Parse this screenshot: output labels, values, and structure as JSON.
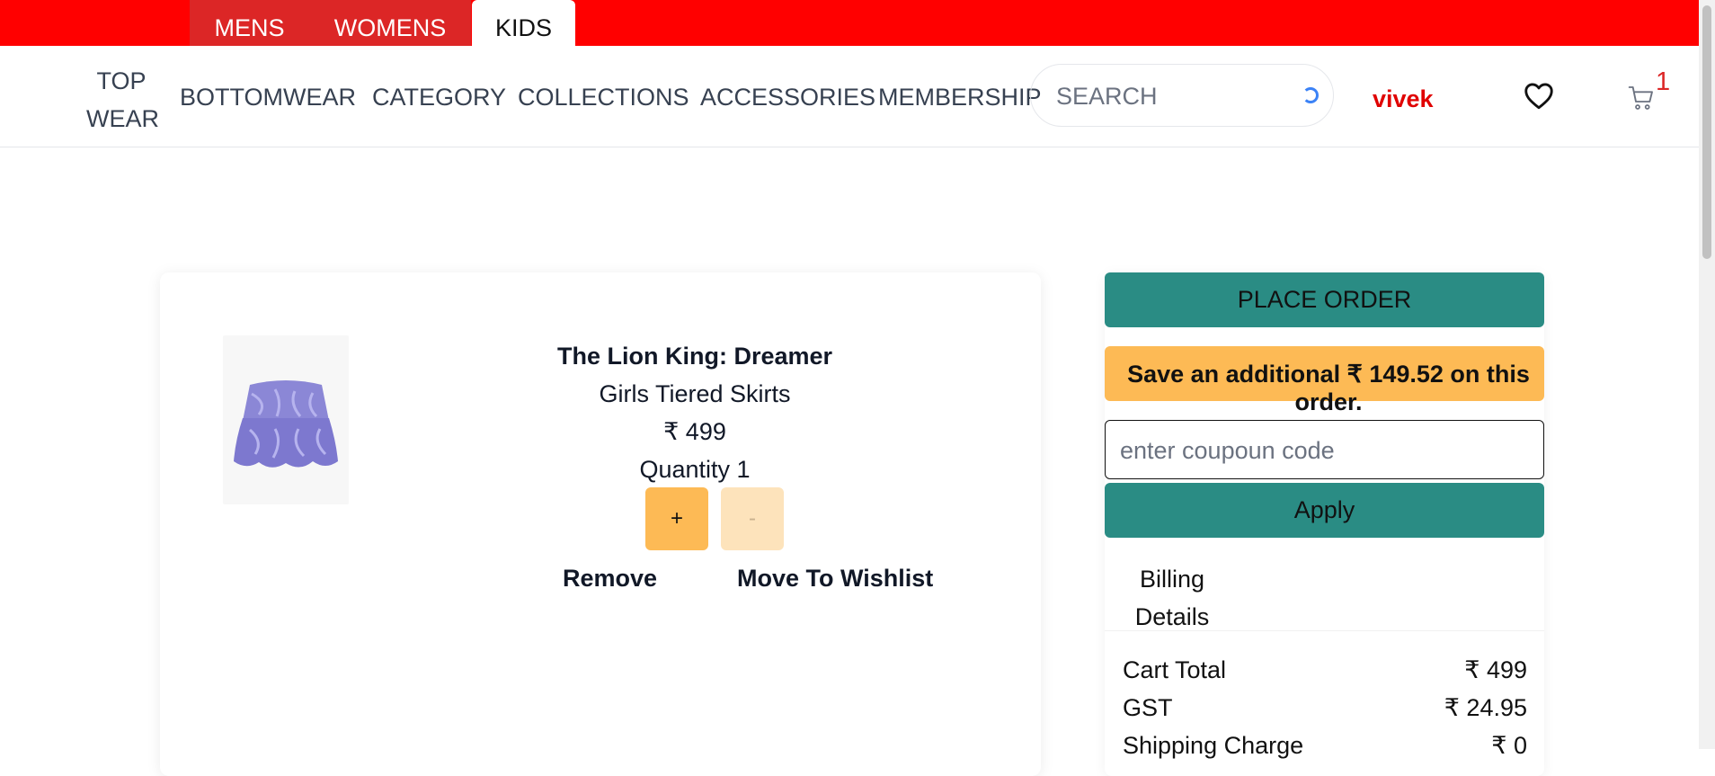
{
  "gender_tabs": [
    {
      "label": "MENS"
    },
    {
      "label": "WOMENS"
    },
    {
      "label": "KIDS"
    }
  ],
  "nav": {
    "top_wear_1": "TOP",
    "top_wear_2": "WEAR",
    "bottomwear": "BOTTOMWEAR",
    "category": "CATEGORY",
    "collections": "COLLECTIONS",
    "accessories": "ACCESSORIES",
    "membership": "MEMBERSHIP"
  },
  "search": {
    "placeholder": "SEARCH"
  },
  "user": {
    "name": "vivek"
  },
  "cart": {
    "count": "1"
  },
  "item": {
    "title": "The Lion King: Dreamer",
    "subtitle": "Girls Tiered Skirts",
    "price": "₹ 499",
    "quantity": "Quantity 1",
    "plus": "+",
    "minus": "-",
    "remove": "Remove",
    "move_to_wishlist": "Move To Wishlist"
  },
  "summary": {
    "place_order": "PLACE ORDER",
    "save_message": "Save an additional ₹ 149.52 on this order.",
    "coupon_placeholder": "enter coupoun code",
    "apply": "Apply",
    "billing_1": "Billing",
    "billing_2": "Details",
    "rows": [
      {
        "label": "Cart Total",
        "value": "₹ 499"
      },
      {
        "label": "GST",
        "value": "₹ 24.95"
      },
      {
        "label": "Shipping Charge",
        "value": "₹ 0"
      }
    ]
  },
  "colors": {
    "topbar": "#ff0000",
    "tab": "#dc2626",
    "teal": "#2a8c84",
    "orange": "#fdba55",
    "light_orange": "#fde3bb",
    "username": "#e00000"
  }
}
